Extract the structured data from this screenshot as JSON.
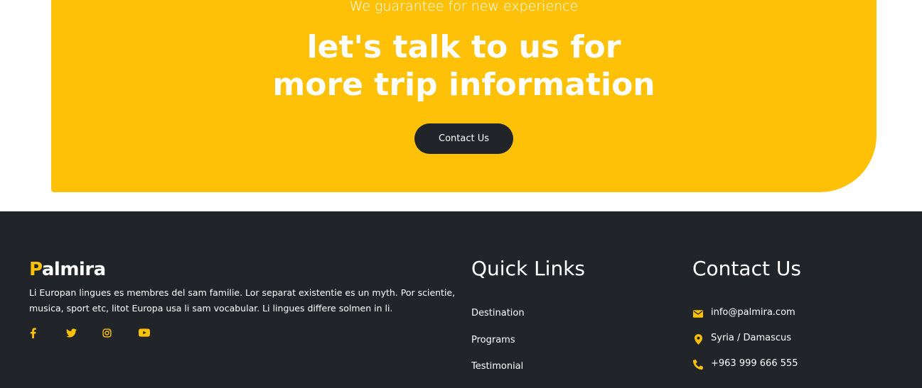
{
  "cta": {
    "subtitle": "We guarantee for new experience",
    "title_line1": "let's talk to us for",
    "title_line2": "more trip information",
    "button_label": "Contact Us",
    "background_color": "#ffc107",
    "button_color": "#212529"
  },
  "footer": {
    "background_color": "#212529",
    "accent_color": "#ffc107",
    "brand": {
      "first_letter": "P",
      "rest": "almira"
    },
    "description": "Li Europan lingues es membres del sam familie. Lor separat existentie es un myth. Por scientie, musica, sport etc, litot Europa usa li sam vocabular. Li lingues differe solmen in li.",
    "social": [
      {
        "icon": "facebook-icon"
      },
      {
        "icon": "twitter-icon"
      },
      {
        "icon": "instagram-icon"
      },
      {
        "icon": "youtube-icon"
      }
    ],
    "quick_links": {
      "title": "Quick Links",
      "items": [
        {
          "label": "Destination"
        },
        {
          "label": "Programs"
        },
        {
          "label": "Testimonial"
        }
      ]
    },
    "contact": {
      "title": "Contact Us",
      "items": [
        {
          "icon": "envelope-icon",
          "text": "info@palmira.com"
        },
        {
          "icon": "map-pin-icon",
          "text": "Syria / Damascus"
        },
        {
          "icon": "phone-icon",
          "text": "+963 999 666 555"
        }
      ]
    }
  }
}
